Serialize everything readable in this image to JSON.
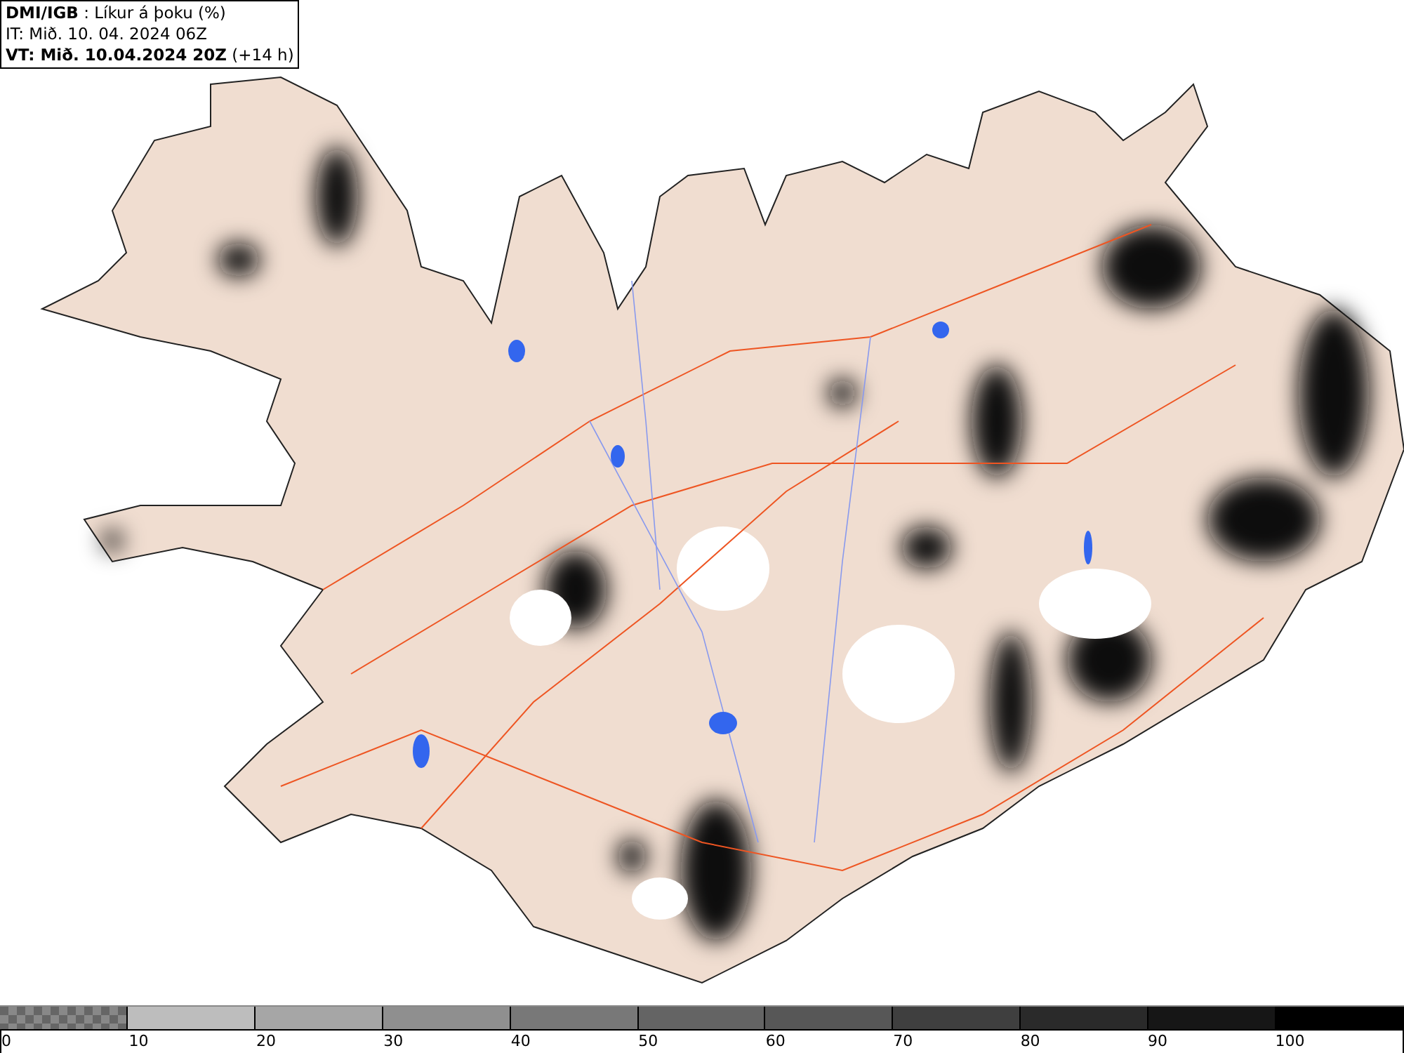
{
  "header": {
    "lines": [
      "**DMI/IGB** : Líkur á þoku (%)",
      "IT: Mið. 10. 04. 2024 06Z",
      "**VT: Mið. 10.04.2024 20Z** (+14 h)"
    ]
  },
  "legend": {
    "segments": [
      {
        "kind": "checker",
        "color": "#666666"
      },
      {
        "kind": "solid",
        "color": "#bdbdbd"
      },
      {
        "kind": "solid",
        "color": "#a6a6a6"
      },
      {
        "kind": "solid",
        "color": "#8f8f8f"
      },
      {
        "kind": "solid",
        "color": "#787878"
      },
      {
        "kind": "solid",
        "color": "#646464"
      },
      {
        "kind": "solid",
        "color": "#575757"
      },
      {
        "kind": "solid",
        "color": "#3f3f3f"
      },
      {
        "kind": "solid",
        "color": "#2a2a2a"
      },
      {
        "kind": "solid",
        "color": "#161616"
      },
      {
        "kind": "solid",
        "color": "#000000"
      }
    ],
    "ticks": [
      "0",
      "10",
      "20",
      "30",
      "40",
      "50",
      "60",
      "70",
      "80",
      "90",
      "100"
    ]
  }
}
